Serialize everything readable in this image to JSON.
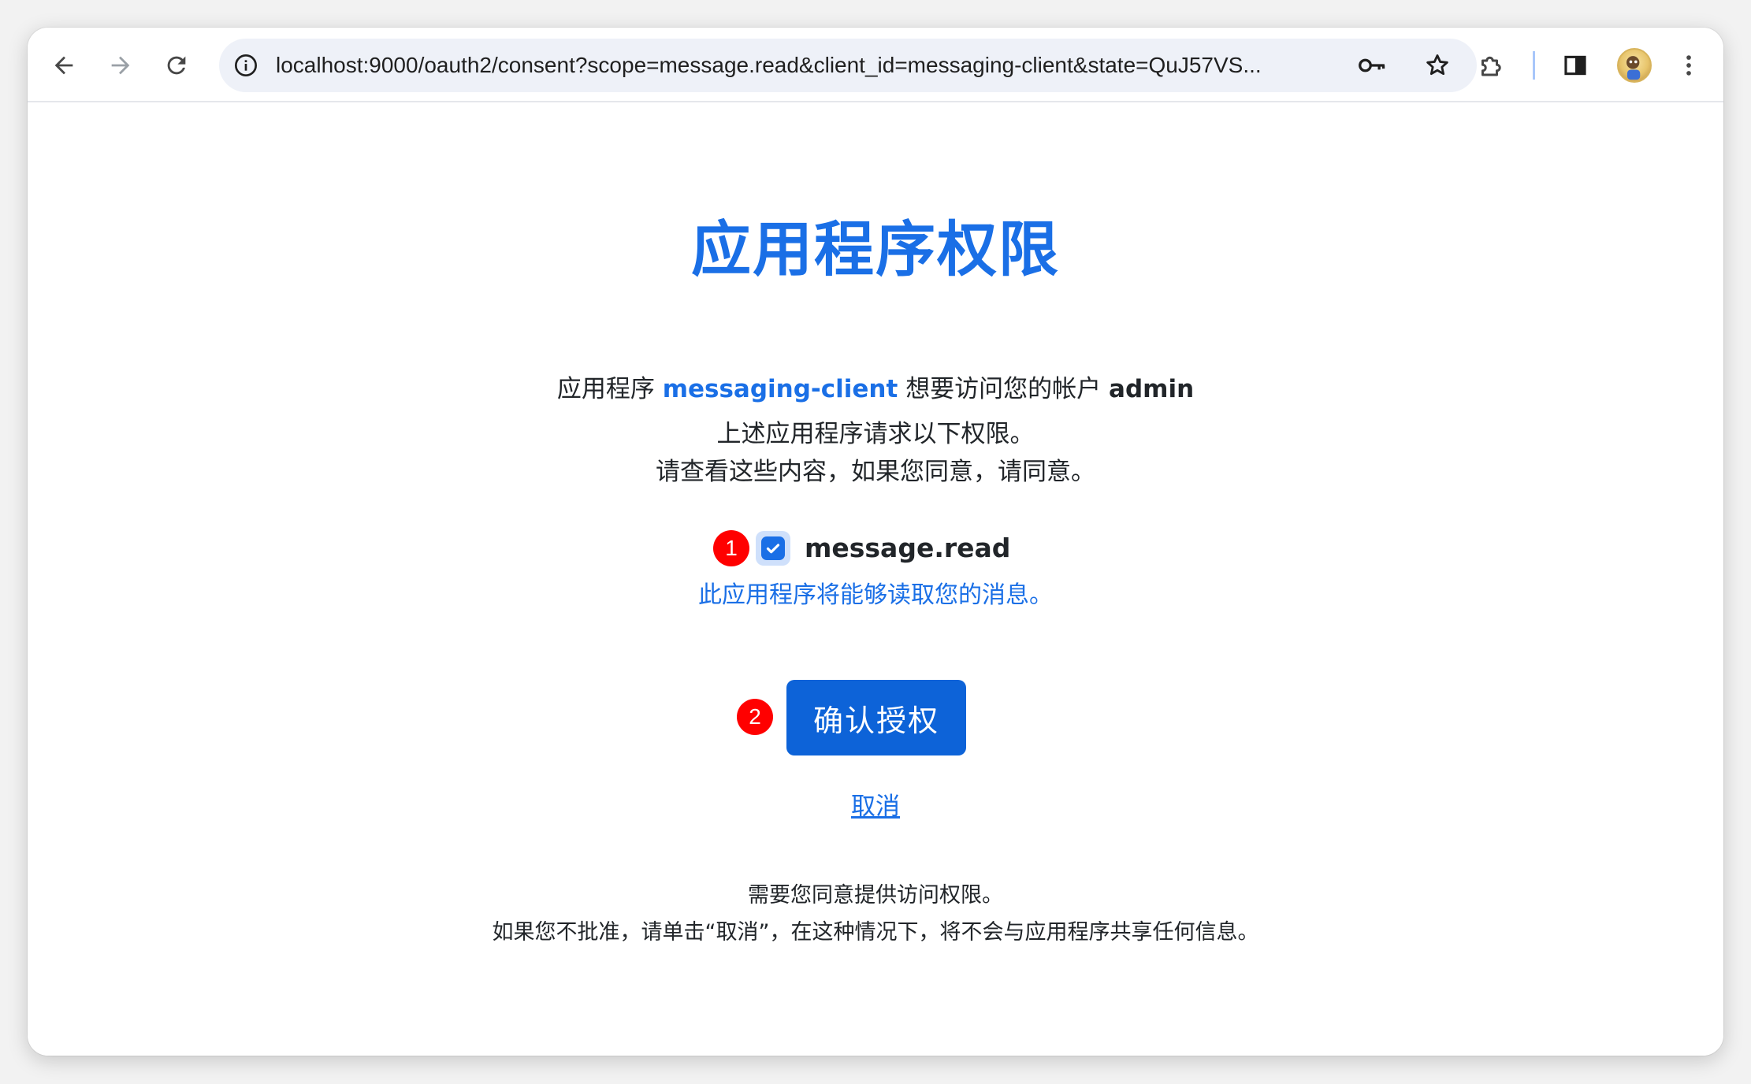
{
  "browser": {
    "url": "localhost:9000/oauth2/consent?scope=message.read&client_id=messaging-client&state=QuJ57VS...",
    "icons": [
      "back-arrow-icon",
      "forward-arrow-icon",
      "reload-icon",
      "site-info-icon",
      "key-icon",
      "star-icon",
      "extensions-icon",
      "side-panel-icon",
      "profile-avatar",
      "more-vert-icon"
    ]
  },
  "page": {
    "title": "应用程序权限",
    "lead_prefix": "应用程序",
    "client_id": "messaging-client",
    "lead_middle": "想要访问您的帐户",
    "principal": "admin",
    "intro_line1": "上述应用程序请求以下权限。",
    "intro_line2": "请查看这些内容，如果您同意，请同意。"
  },
  "scope": {
    "badge": "1",
    "name": "message.read",
    "checked": true,
    "description": "此应用程序将能够读取您的消息。"
  },
  "actions": {
    "confirm_badge": "2",
    "confirm_label": "确认授权",
    "cancel_label": "取消"
  },
  "footer": {
    "line1": "需要您同意提供访问权限。",
    "line2": "如果您不批准，请单击“取消”，在这种情况下，将不会与应用程序共享任何信息。"
  },
  "colors": {
    "accent": "#1a6fe6",
    "button": "#0d63d8",
    "badge": "#ff0000"
  }
}
